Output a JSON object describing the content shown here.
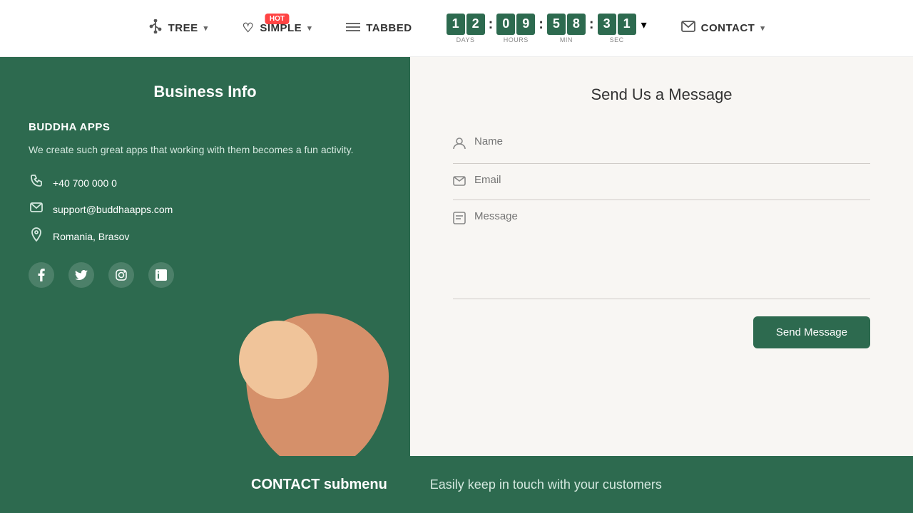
{
  "navbar": {
    "items": [
      {
        "id": "tree",
        "label": "TREE",
        "icon": "⊞",
        "hasChevron": true
      },
      {
        "id": "simple",
        "label": "SIMPLE",
        "icon": "♡",
        "hasChevron": true,
        "hot": true
      },
      {
        "id": "tabbed",
        "label": "TABBED",
        "icon": "≡",
        "hasChevron": false
      },
      {
        "id": "contact",
        "label": "CONTACT",
        "icon": "✉",
        "hasChevron": true
      }
    ],
    "countdown": {
      "days": [
        "1",
        "2"
      ],
      "hours": [
        "0",
        "9"
      ],
      "min": [
        "5",
        "8"
      ],
      "sec": [
        "3",
        "1"
      ],
      "labels": [
        "DAYS",
        "HOURS",
        "MIN",
        "SEC"
      ]
    }
  },
  "business": {
    "panel_title": "Business Info",
    "company_name": "BUDDHA APPS",
    "description": "We create such great apps that working with them becomes a fun activity.",
    "phone": "+40 700 000 0",
    "email": "support@buddhaapps.com",
    "location": "Romania, Brasov",
    "social": [
      "f",
      "t",
      "in",
      "li"
    ]
  },
  "form": {
    "title": "Send Us a Message",
    "name_placeholder": "Name",
    "email_placeholder": "Email",
    "message_placeholder": "Message",
    "send_label": "Send Message"
  },
  "footer": {
    "heading": "CONTACT submenu",
    "subtitle": "Easily keep in touch with your customers"
  }
}
